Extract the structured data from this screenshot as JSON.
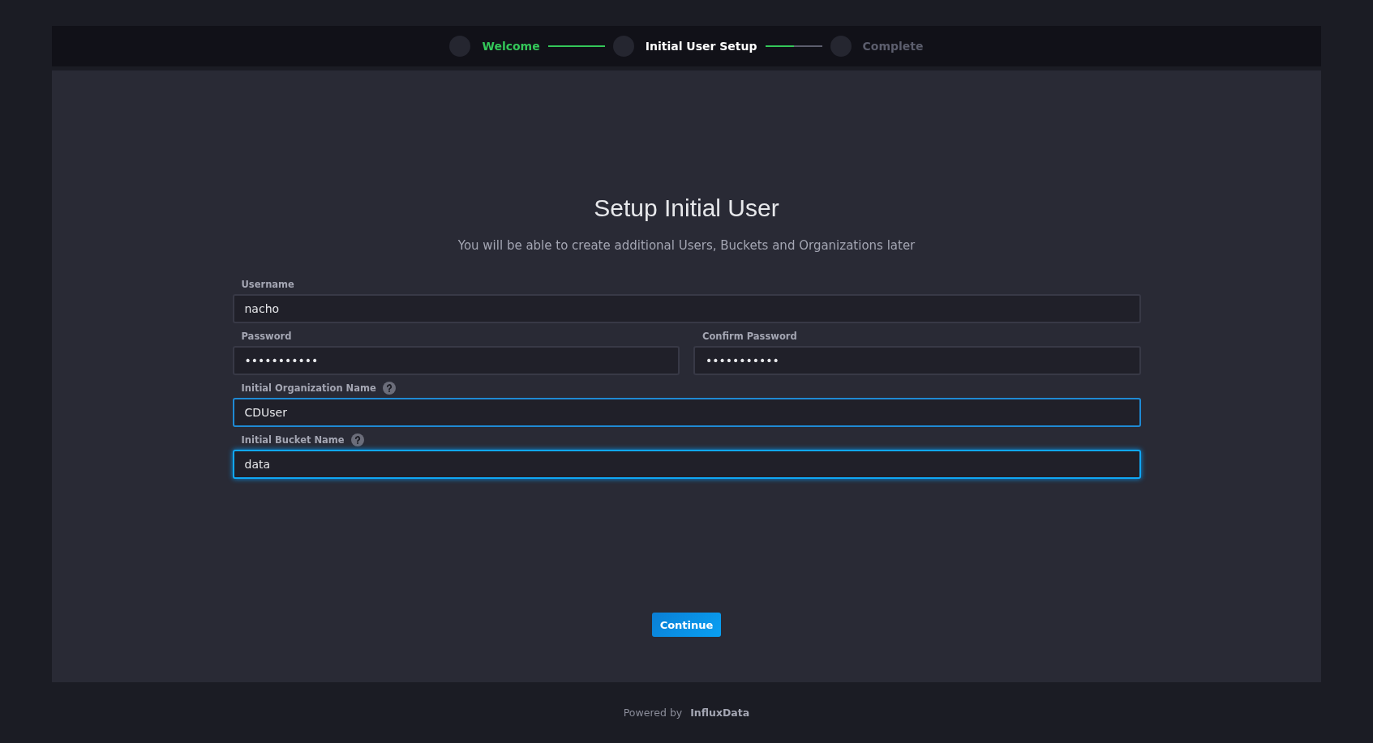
{
  "steps": [
    {
      "label": "Welcome",
      "done": true,
      "selected": false
    },
    {
      "label": "Initial User Setup",
      "done": false,
      "selected": true
    },
    {
      "label": "Complete",
      "done": false,
      "selected": false
    }
  ],
  "connectors": [
    {
      "level": 1
    },
    {
      "level": 0.5
    }
  ],
  "title": "Setup Initial User",
  "subtitle": "You will be able to create additional Users, Buckets and Organizations later",
  "rows": [
    {
      "fields": [
        {
          "label": "Username",
          "value": "nacho",
          "help": false,
          "valid": false,
          "focused": false
        }
      ]
    },
    {
      "fields": [
        {
          "label": "Password",
          "value": "•••••••••••",
          "help": false,
          "valid": false,
          "focused": false
        },
        {
          "label": "Confirm Password",
          "value": "•••••••••••",
          "help": false,
          "valid": false,
          "focused": false
        }
      ]
    },
    {
      "fields": [
        {
          "label": "Initial Organization Name",
          "value": "CDUser",
          "help": true,
          "valid": true,
          "focused": false
        }
      ]
    },
    {
      "fields": [
        {
          "label": "Initial Bucket Name",
          "value": "data",
          "help": true,
          "valid": false,
          "focused": true
        }
      ]
    }
  ],
  "button": "Continue",
  "footer": {
    "prefix": "Powered by",
    "brand": "InfluxData"
  }
}
